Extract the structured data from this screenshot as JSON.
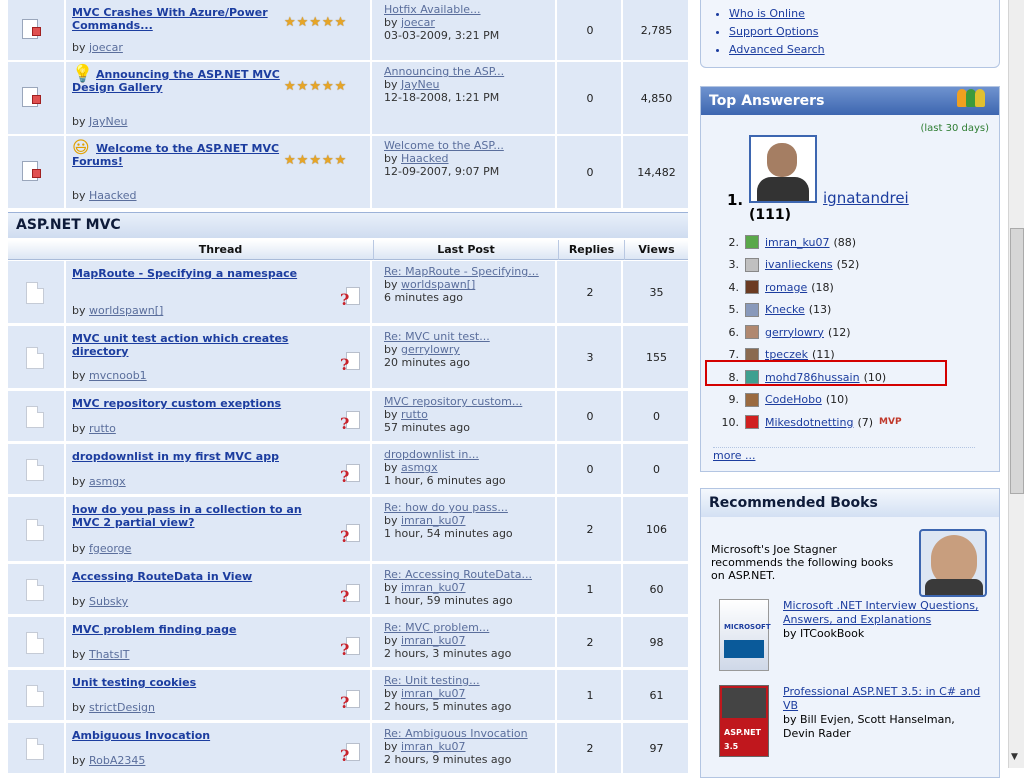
{
  "top_threads": [
    {
      "title": "MVC Crashes With Azure/Power Commands...",
      "author": "joecar",
      "last_post_title": "Hotfix Available...",
      "last_post_author": "joecar",
      "last_post_time": "03-03-2009, 3:21 PM",
      "replies": "0",
      "views": "2,785",
      "emoji": "",
      "stars": 5
    },
    {
      "title": "Announcing the ASP.NET MVC Design Gallery",
      "author": "JayNeu",
      "last_post_title": "Announcing the ASP...",
      "last_post_author": "JayNeu",
      "last_post_time": "12-18-2008, 1:21 PM",
      "replies": "0",
      "views": "4,850",
      "emoji": "bulb",
      "stars": 5
    },
    {
      "title": "Welcome to the ASP.NET MVC Forums!",
      "author": "Haacked",
      "last_post_title": "Welcome to the ASP...",
      "last_post_author": "Haacked",
      "last_post_time": "12-09-2007, 9:07 PM",
      "replies": "0",
      "views": "14,482",
      "emoji": "smile",
      "stars": 5
    }
  ],
  "section_title": "ASP.NET MVC",
  "columns": {
    "thread": "Thread",
    "last_post": "Last Post",
    "replies": "Replies",
    "views": "Views"
  },
  "threads": [
    {
      "title": "MapRoute - Specifying a namespace",
      "author": "worldspawn[]",
      "last_post_title": "Re: MapRoute - Specifying...",
      "last_post_author": "worldspawn[]",
      "last_post_time": "6 minutes ago",
      "replies": "2",
      "views": "35"
    },
    {
      "title": "MVC unit test action which creates directory",
      "author": "mvcnoob1",
      "last_post_title": "Re: MVC unit test...",
      "last_post_author": "gerrylowry",
      "last_post_time": "20 minutes ago",
      "replies": "3",
      "views": "155"
    },
    {
      "title": "MVC repository custom exeptions",
      "author": "rutto",
      "last_post_title": "MVC repository custom...",
      "last_post_author": "rutto",
      "last_post_time": "57 minutes ago",
      "replies": "0",
      "views": "0"
    },
    {
      "title": "dropdownlist in my first MVC app",
      "author": "asmgx",
      "last_post_title": "dropdownlist in...",
      "last_post_author": "asmgx",
      "last_post_time": "1 hour, 6 minutes ago",
      "replies": "0",
      "views": "0"
    },
    {
      "title": "how do you pass in a collection to an MVC 2 partial view?",
      "author": "fgeorge",
      "last_post_title": "Re: how do you pass...",
      "last_post_author": "imran_ku07",
      "last_post_time": "1 hour, 54 minutes ago",
      "replies": "2",
      "views": "106"
    },
    {
      "title": "Accessing RouteData in View",
      "author": "Subsky",
      "last_post_title": "Re: Accessing RouteData...",
      "last_post_author": "imran_ku07",
      "last_post_time": "1 hour, 59 minutes ago",
      "replies": "1",
      "views": "60"
    },
    {
      "title": "MVC problem finding page",
      "author": "ThatsIT",
      "last_post_title": "Re: MVC problem...",
      "last_post_author": "imran_ku07",
      "last_post_time": "2 hours, 3 minutes ago",
      "replies": "2",
      "views": "98"
    },
    {
      "title": "Unit testing cookies",
      "author": "strictDesign",
      "last_post_title": "Re: Unit testing...",
      "last_post_author": "imran_ku07",
      "last_post_time": "2 hours, 5 minutes ago",
      "replies": "1",
      "views": "61"
    },
    {
      "title": "Ambiguous Invocation",
      "author": "RobA2345",
      "last_post_title": "Re: Ambiguous Invocation",
      "last_post_author": "imran_ku07",
      "last_post_time": "2 hours, 9 minutes ago",
      "replies": "2",
      "views": "97"
    }
  ],
  "by_label": "by",
  "quick_links": [
    "Who is Online",
    "Support Options",
    "Advanced Search"
  ],
  "top_answerers": {
    "title": "Top Answerers",
    "period": "(last 30 days)",
    "first": {
      "rank": "1.",
      "name": "ignatandrei",
      "count": "(111)"
    },
    "others": [
      {
        "rank": "2.",
        "name": "imran_ku07",
        "count": "(88)",
        "color": "#5aa84a"
      },
      {
        "rank": "3.",
        "name": "ivanlieckens",
        "count": "(52)",
        "color": "#c0c0c0"
      },
      {
        "rank": "4.",
        "name": "romage",
        "count": "(18)",
        "color": "#6b3b22"
      },
      {
        "rank": "5.",
        "name": "Knecke",
        "count": "(13)",
        "color": "#8899bb"
      },
      {
        "rank": "6.",
        "name": "gerrylowry",
        "count": "(12)",
        "color": "#b08870"
      },
      {
        "rank": "7.",
        "name": "tpeczek",
        "count": "(11)",
        "color": "#8a6a50"
      },
      {
        "rank": "8.",
        "name": "mohd786hussain",
        "count": "(10)",
        "color": "#3fa090"
      },
      {
        "rank": "9.",
        "name": "CodeHobo",
        "count": "(10)",
        "color": "#9a6a40"
      },
      {
        "rank": "10.",
        "name": "Mikesdotnetting",
        "count": "(7)",
        "color": "#d02020",
        "badge": "MVP"
      }
    ],
    "more": "more ..."
  },
  "books": {
    "title": "Recommended Books",
    "intro": "Microsoft's Joe Stagner recommends the following books on ASP.NET.",
    "items": [
      {
        "title": "Microsoft .NET Interview Questions, Answers, and Explanations",
        "by": "by ITCookBook"
      },
      {
        "title": "Professional ASP.NET 3.5: in C# and VB",
        "by": "by Bill Evjen, Scott Hanselman, Devin Rader"
      }
    ]
  }
}
